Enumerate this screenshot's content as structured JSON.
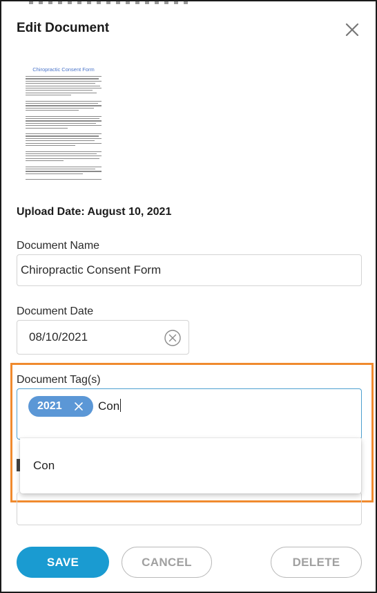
{
  "dialog": {
    "title": "Edit Document",
    "close_icon": "close-icon"
  },
  "thumbnail": {
    "title": "Chiropractic Consent Form"
  },
  "upload_date": "Upload Date: August 10, 2021",
  "document_name": {
    "label": "Document Name",
    "value": "Chiropractic Consent Form"
  },
  "document_date": {
    "label": "Document Date",
    "value": "08/10/2021",
    "clear_icon": "clear-circle-icon"
  },
  "document_tags": {
    "label": "Document Tag(s)",
    "tags": [
      {
        "label": "2021",
        "remove_icon": "close-icon"
      }
    ],
    "typed_text": "Con",
    "suggestions": [
      "Con"
    ]
  },
  "actions": {
    "save": "SAVE",
    "cancel": "CANCEL",
    "delete": "DELETE"
  },
  "colors": {
    "primary": "#1a9bd1",
    "chip": "#5b97d6",
    "highlight": "#f08a2e",
    "focus_border": "#4b9fcf"
  }
}
